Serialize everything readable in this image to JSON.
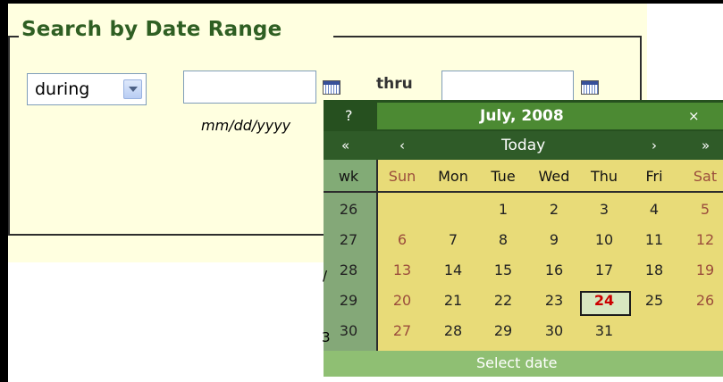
{
  "search": {
    "legend": "Search by Date Range",
    "range_select": {
      "value": "during"
    },
    "from_input": {
      "value": "",
      "hint": "mm/dd/yyyy"
    },
    "thru_label": "thru",
    "to_input": {
      "value": ""
    }
  },
  "calendar": {
    "help_label": "?",
    "title": "July, 2008",
    "close_label": "×",
    "nav": {
      "prev_year": "«",
      "prev_month": "‹",
      "today": "Today",
      "next_month": "›",
      "next_year": "»"
    },
    "week_label": "wk",
    "day_headers": [
      "Sun",
      "Mon",
      "Tue",
      "Wed",
      "Thu",
      "Fri",
      "Sat"
    ],
    "weeks": [
      {
        "wk": "26",
        "days": [
          "",
          "",
          "1",
          "2",
          "3",
          "4",
          "5"
        ]
      },
      {
        "wk": "27",
        "days": [
          "6",
          "7",
          "8",
          "9",
          "10",
          "11",
          "12"
        ]
      },
      {
        "wk": "28",
        "days": [
          "13",
          "14",
          "15",
          "16",
          "17",
          "18",
          "19"
        ]
      },
      {
        "wk": "29",
        "days": [
          "20",
          "21",
          "22",
          "23",
          "24",
          "25",
          "26"
        ]
      },
      {
        "wk": "30",
        "days": [
          "27",
          "28",
          "29",
          "30",
          "31",
          "",
          ""
        ]
      }
    ],
    "selected_day": "24",
    "footer": "Select date"
  },
  "colors": {
    "legend": "#2f5f23",
    "calendar_header": "#26501f",
    "calendar_title_band": "#4c8a33",
    "calendar_body": "#e8db78",
    "weekend": "#9b4d3c",
    "today": "#cc0000"
  }
}
